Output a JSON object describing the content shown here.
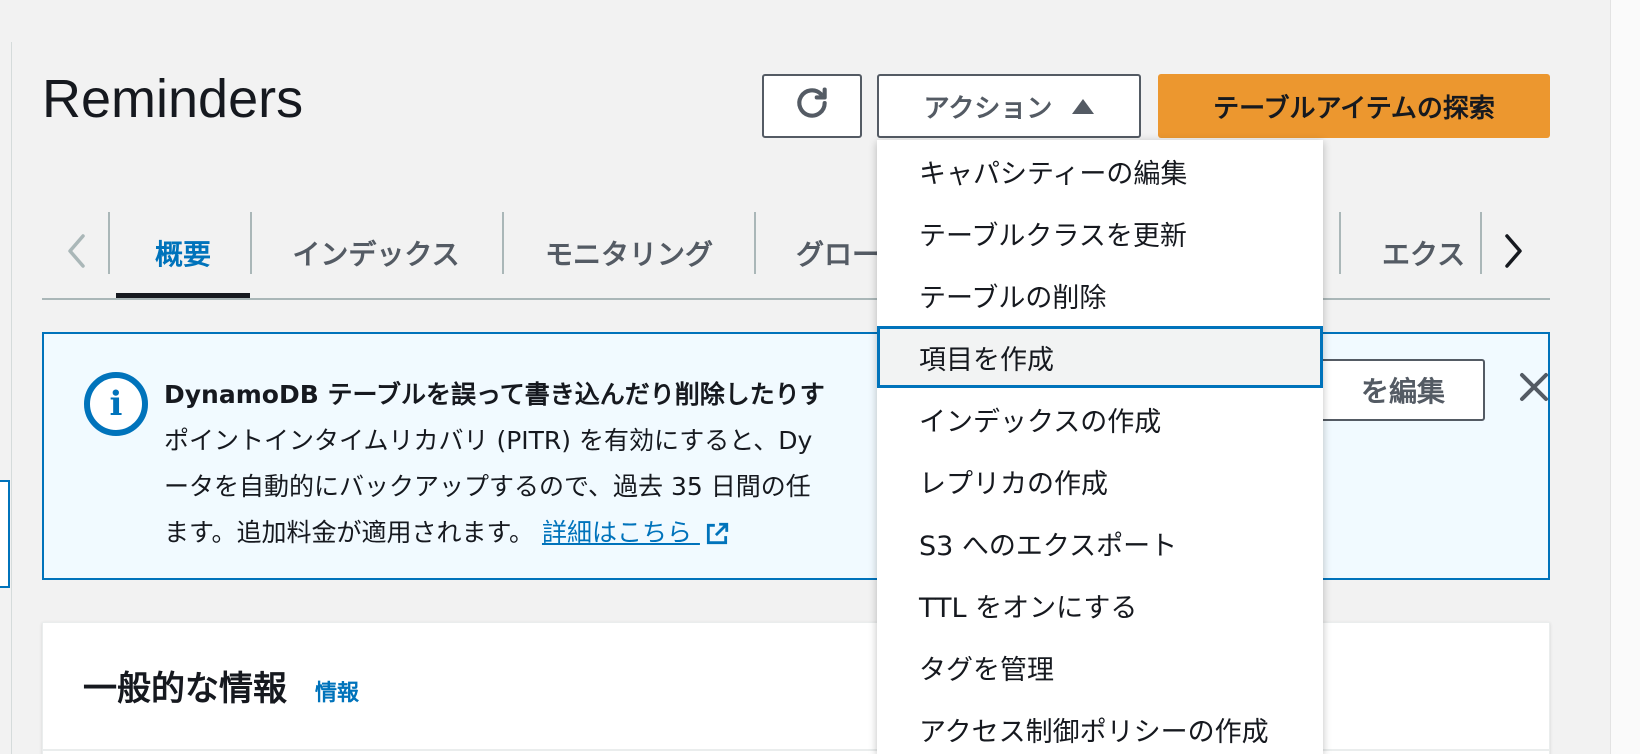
{
  "page": {
    "title": "Reminders"
  },
  "header": {
    "refresh_label": "",
    "actions_label": "アクション",
    "explore_label": "テーブルアイテムの探索"
  },
  "tabs": [
    {
      "label": "概要",
      "active": true
    },
    {
      "label": "インデックス",
      "active": false
    },
    {
      "label": "モニタリング",
      "active": false
    },
    {
      "label": "グロー",
      "active": false
    },
    {
      "label": "エクス",
      "active": false
    }
  ],
  "alert": {
    "title": "DynamoDB テーブルを誤って書き込んだり削除したりす",
    "line1": "ポイントインタイムリカバリ (PITR) を有効にすると、Dy",
    "line2": "ータを自動的にバックアップするので、過去 35 日間の任",
    "line3": "ます。追加料金が適用されます。",
    "link_label": "詳細はこちら",
    "edit_button_label": "を編集"
  },
  "panel": {
    "title": "一般的な情報",
    "info_link": "情報"
  },
  "actions_menu": {
    "items": [
      {
        "label": "キャパシティーの編集",
        "highlighted": false
      },
      {
        "label": "テーブルクラスを更新",
        "highlighted": false
      },
      {
        "label": "テーブルの削除",
        "highlighted": false
      },
      {
        "label": "項目を作成",
        "highlighted": true
      },
      {
        "label": "インデックスの作成",
        "highlighted": false
      },
      {
        "label": "レプリカの作成",
        "highlighted": false
      },
      {
        "label": "S3 へのエクスポート",
        "highlighted": false
      },
      {
        "label": "TTL をオンにする",
        "highlighted": false
      },
      {
        "label": "タグを管理",
        "highlighted": false
      },
      {
        "label": "アクセス制御ポリシーの作成",
        "highlighted": false
      }
    ]
  },
  "colors": {
    "accent": "#0073bb",
    "primary_button": "#ec972f",
    "background": "#f2f2f2"
  }
}
